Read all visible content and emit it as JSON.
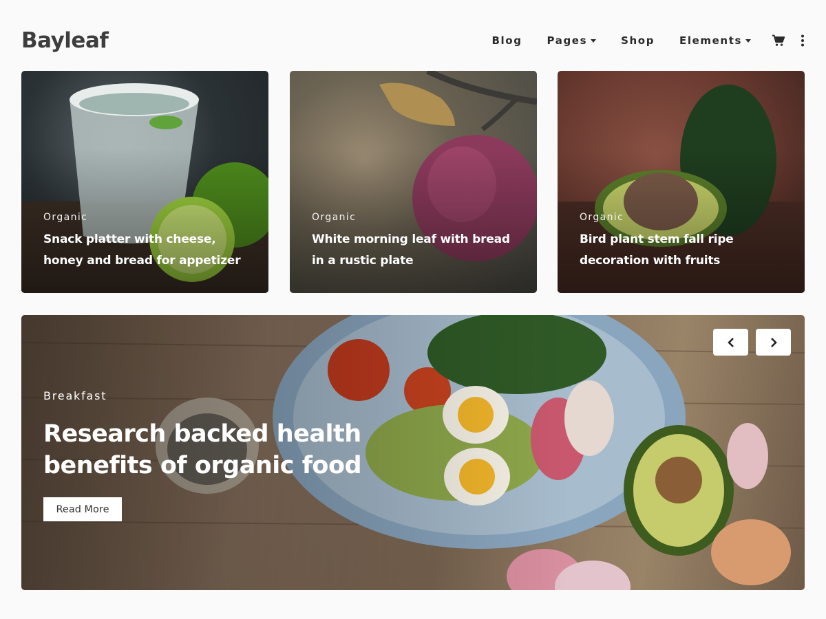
{
  "header": {
    "logo": "Bayleaf",
    "nav": [
      {
        "label": "Blog",
        "has_dropdown": false
      },
      {
        "label": "Pages",
        "has_dropdown": true
      },
      {
        "label": "Shop",
        "has_dropdown": false
      },
      {
        "label": "Elements",
        "has_dropdown": true
      }
    ],
    "icons": [
      "cart-icon",
      "more-vertical-icon"
    ]
  },
  "cards": [
    {
      "category": "Organic",
      "title": "Snack platter with cheese, honey and bread for appetizer"
    },
    {
      "category": "Organic",
      "title": "White morning leaf with bread in a rustic plate"
    },
    {
      "category": "Organic",
      "title": "Bird plant stem fall ripe decoration with fruits"
    }
  ],
  "hero": {
    "category": "Breakfast",
    "title": "Research backed health benefits of organic food",
    "button_label": "Read More",
    "controls": [
      "chevron-left-icon",
      "chevron-right-icon"
    ]
  },
  "colors": {
    "background": "#fafafa",
    "text_dark": "#2a2a2a",
    "logo": "#3d3d3d",
    "overlay_text": "#ffffff"
  }
}
